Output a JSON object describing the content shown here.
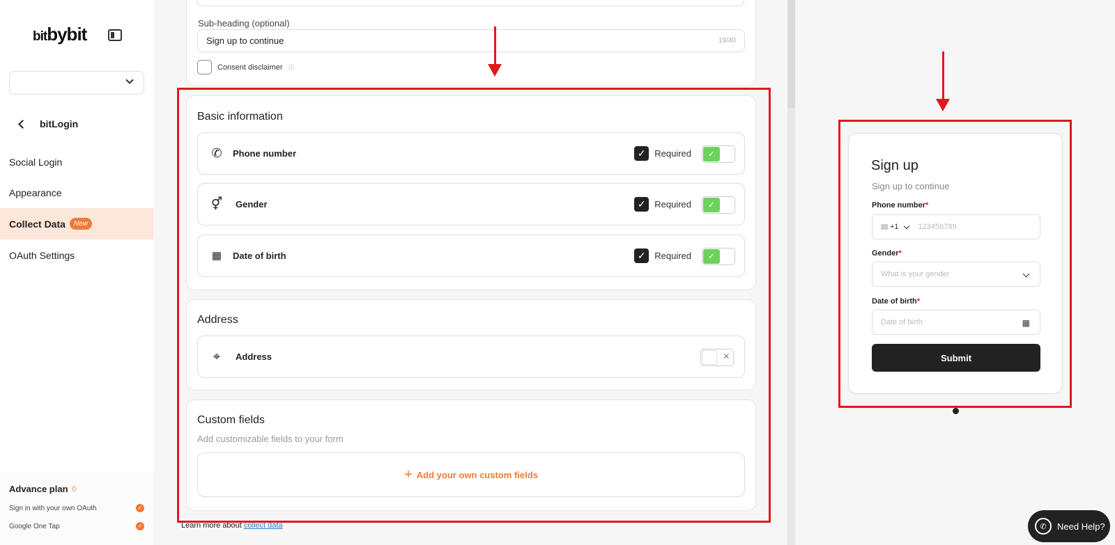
{
  "sidebar": {
    "logo_small": "bit",
    "logo_big": "bybit",
    "select_value": "",
    "back_label": "bitLogin",
    "nav": [
      {
        "label": "Social Login"
      },
      {
        "label": "Appearance"
      },
      {
        "label": "Collect Data",
        "badge": "New",
        "active": true
      },
      {
        "label": "OAuth Settings"
      }
    ],
    "plan": {
      "title": "Advance plan",
      "features": [
        "Sign in with your own OAuth",
        "Google One Tap"
      ]
    }
  },
  "main": {
    "subheading_label": "Sub-heading (optional)",
    "subheading_value": "Sign up to continue",
    "subheading_counter": "19/40",
    "consent_label": "Consent disclaimer",
    "basic": {
      "title": "Basic information",
      "fields": [
        {
          "label": "Phone number",
          "required_label": "Required",
          "required": true,
          "enabled": true
        },
        {
          "label": "Gender",
          "required_label": "Required",
          "required": true,
          "enabled": true
        },
        {
          "label": "Date of birth",
          "required_label": "Required",
          "required": true,
          "enabled": true
        }
      ]
    },
    "address": {
      "title": "Address",
      "field_label": "Address",
      "enabled": false
    },
    "custom": {
      "title": "Custom fields",
      "subtitle": "Add customizable fields to your form",
      "add_label": "Add your own custom fields"
    },
    "learn_prefix": "Learn more about",
    "learn_link": "collect data"
  },
  "preview": {
    "title": "Sign up",
    "subtitle": "Sign up to continue",
    "phone_label": "Phone number",
    "phone_code": "+1",
    "phone_placeholder": "123456789",
    "gender_label": "Gender",
    "gender_placeholder": "What is your gender",
    "dob_label": "Date of birth",
    "dob_placeholder": "Date of birth",
    "submit_label": "Submit",
    "required_mark": "*"
  },
  "help": {
    "label": "Need Help?"
  },
  "colors": {
    "accent": "#f07a36",
    "toggle_on": "#6cd25b",
    "annotation": "#e0191b",
    "active_nav_bg": "#fde7da"
  }
}
